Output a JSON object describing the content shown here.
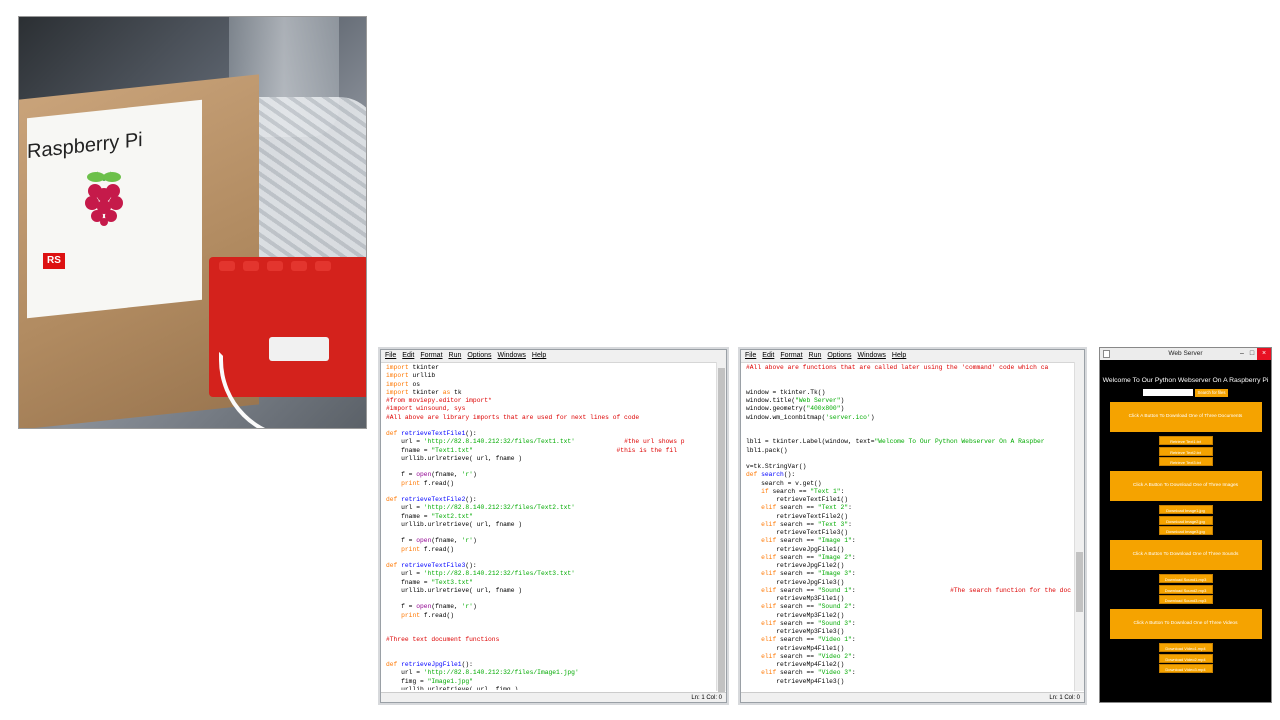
{
  "photo": {
    "brand_text": "Raspberry Pi",
    "rs_logo": "RS"
  },
  "editor_menu": [
    "File",
    "Edit",
    "Format",
    "Run",
    "Options",
    "Windows",
    "Help"
  ],
  "editor1": {
    "status": "Ln: 1 Col: 0"
  },
  "editor2": {
    "status": "Ln: 1 Col: 0"
  },
  "webserver": {
    "window_title": "Web Server",
    "heading": "Welcome To Our Python Webserver On A Raspberry Pi",
    "search_value": "",
    "search_button": "Search for files",
    "sections": [
      {
        "title": "Click A Button To Download One of Three Documents",
        "buttons": [
          "Retrieve Text1.txt",
          "Retrieve Text2.txt",
          "Retrieve Text3.txt"
        ]
      },
      {
        "title": "Click A Button To Download One of Three Images",
        "buttons": [
          "Download Image1.jpg",
          "Download Image2.jpg",
          "Download Image3.jpg"
        ]
      },
      {
        "title": "Click A Button To Download One of Three Sounds",
        "buttons": [
          "Download Sound1.mp3",
          "Download Sound2.mp3",
          "Download Sound3.mp3"
        ]
      },
      {
        "title": "Click A Button To Download One of Three Videos",
        "buttons": [
          "Download Video1.mp4",
          "Download Video2.mp4",
          "Download Video3.mp4"
        ]
      }
    ]
  },
  "colors": {
    "keyword": "#ff7700",
    "string": "#00aa00",
    "comment": "#dd0000",
    "definition": "#0000ff",
    "builtin": "#900090",
    "button_orange": "#f5a300"
  }
}
